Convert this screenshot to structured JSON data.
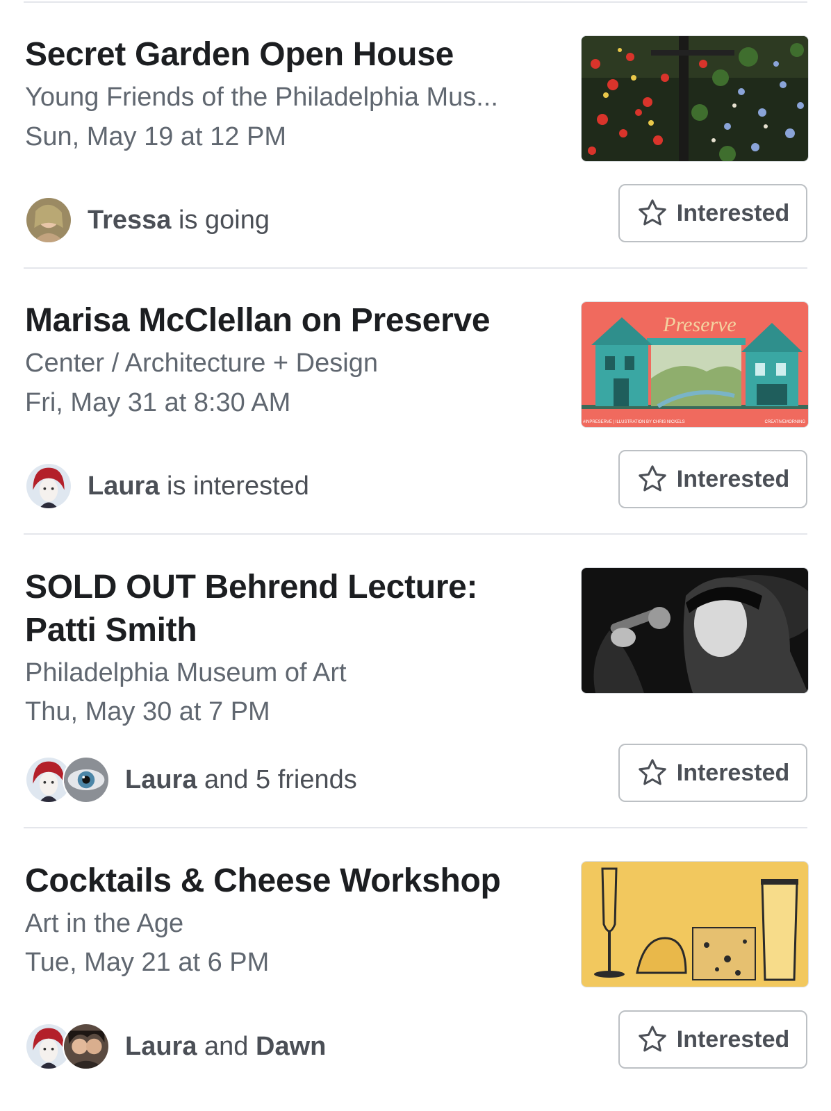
{
  "events": [
    {
      "title": "Secret Garden Open House",
      "host": "Young Friends of the Philadelphia Mus...",
      "date": "Sun, May 19 at 12 PM",
      "social": {
        "name1": "Tressa",
        "mid": " is going",
        "name2": ""
      },
      "button": "Interested",
      "image": "garden-photo",
      "avatars": [
        "tressa-avatar"
      ]
    },
    {
      "title": "Marisa McClellan on Preserve",
      "host": "Center / Architecture + Design",
      "date": "Fri, May 31 at 8:30 AM",
      "social": {
        "name1": "Laura",
        "mid": " is interested",
        "name2": ""
      },
      "button": "Interested",
      "image": "preserve-illustration",
      "image_text": "Preserve",
      "image_small_text_left": "#INPRESERVE | ILLUSTRATION BY CHRIS NICKELS",
      "image_small_text_right": "CREATIVEMORNING",
      "avatars": [
        "laura-avatar"
      ]
    },
    {
      "title": "SOLD OUT Behrend Lecture: Patti Smith",
      "host": "Philadelphia Museum of Art",
      "date": "Thu, May 30 at 7 PM",
      "social": {
        "name1": "Laura",
        "mid": " and 5 friends",
        "name2": ""
      },
      "button": "Interested",
      "image": "singer-photo",
      "avatars": [
        "laura-avatar",
        "eye-avatar"
      ]
    },
    {
      "title": "Cocktails & Cheese Workshop",
      "host": "Art in the Age",
      "date": "Tue, May 21 at 6 PM",
      "social": {
        "name1": "Laura",
        "mid": " and ",
        "name2": "Dawn"
      },
      "button": "Interested",
      "image": "cocktail-illustration",
      "avatars": [
        "laura-avatar",
        "dawn-avatar"
      ]
    }
  ],
  "colors": {
    "accent_red": "#f06a5e",
    "teal": "#3aa7a3",
    "yellow": "#f2c85e"
  }
}
